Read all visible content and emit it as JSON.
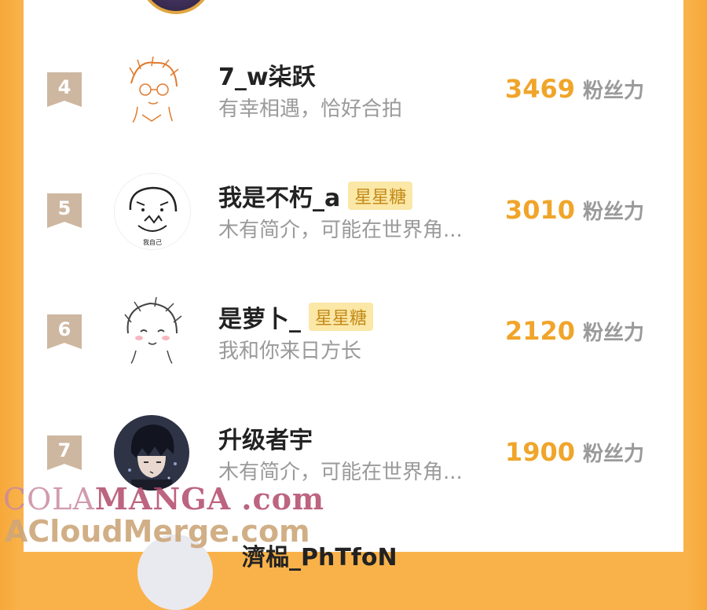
{
  "score_unit": "粉丝力",
  "colors": {
    "accent": "#f0a52a",
    "badge_bg": "#fbe7a6",
    "badge_text": "#c38a19",
    "rank_bg": "#ceb7a0"
  },
  "rows": [
    {
      "rank": "4",
      "name": "7_w柒跃",
      "badge": "",
      "bio": "有幸相遇，恰好合拍",
      "score": "3469",
      "avatar_icon": "sketch-boy-avatar"
    },
    {
      "rank": "5",
      "name": "我是不朽_a",
      "badge": "星星糖",
      "bio": "木有简介，可能在世界角...",
      "score": "3010",
      "avatar_icon": "doodle-face-avatar"
    },
    {
      "rank": "6",
      "name": "是萝卜_",
      "badge": "星星糖",
      "bio": "我和你来日方长",
      "score": "2120",
      "avatar_icon": "anime-sketch-avatar"
    },
    {
      "rank": "7",
      "name": "升级者宇",
      "badge": "",
      "bio": "木有简介，可能在世界角...",
      "score": "1900",
      "avatar_icon": "dark-hair-avatar"
    }
  ],
  "partial_row": {
    "name": "濟榀_PhTfoN"
  },
  "watermark": {
    "line1_a": "COLA",
    "line1_b": "MANGA",
    "line1_c": ".com",
    "line2": "ACloudMerge.com"
  }
}
